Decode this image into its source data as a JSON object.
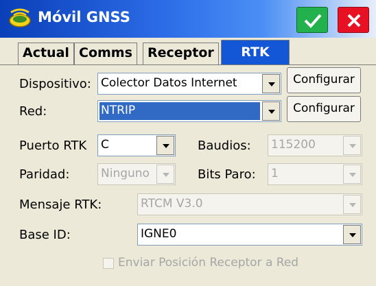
{
  "window": {
    "title": "Móvil GNSS",
    "ok_icon": "checkmark-icon",
    "close_icon": "close-icon",
    "ok_color": "#22b14c",
    "close_color": "#e81123"
  },
  "tabs": [
    {
      "label": "Actual",
      "active": false
    },
    {
      "label": "Comms",
      "active": false
    },
    {
      "label": "Receptor",
      "active": false
    },
    {
      "label": "RTK",
      "active": true
    }
  ],
  "form": {
    "dispositivo": {
      "label": "Dispositivo:",
      "value": "Colector Datos Internet",
      "button": "Configurar"
    },
    "red": {
      "label": "Red:",
      "value": "NTRIP",
      "button": "Configurar"
    },
    "puerto_rtk": {
      "label": "Puerto RTK",
      "value": "C"
    },
    "baudios": {
      "label": "Baudios:",
      "value": "115200"
    },
    "paridad": {
      "label": "Paridad:",
      "value": "Ninguno"
    },
    "bits_paro": {
      "label": "Bits Paro:",
      "value": "1"
    },
    "mensaje_rtk": {
      "label": "Mensaje RTK:",
      "value": "RTCM V3.0"
    },
    "base_id": {
      "label": "Base ID:",
      "value": "IGNE0"
    },
    "enviar_posicion": {
      "label": "Enviar Posición Receptor a Red",
      "checked": false
    }
  }
}
